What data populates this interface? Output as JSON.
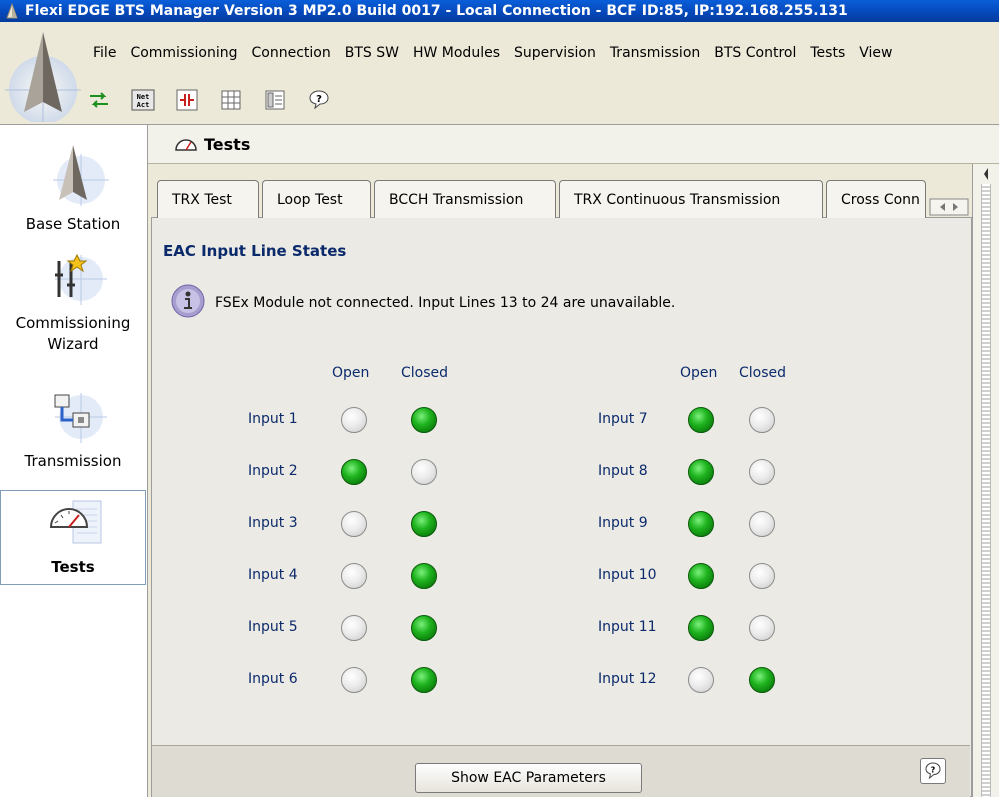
{
  "window": {
    "title": "Flexi EDGE BTS Manager Version 3 MP2.0 Build 0017 - Local Connection - BCF ID:85,  IP:192.168.255.131"
  },
  "menu": [
    "File",
    "Commissioning",
    "Connection",
    "BTS SW",
    "HW Modules",
    "Supervision",
    "Transmission",
    "BTS Control",
    "Tests",
    "View"
  ],
  "toolbar": {
    "buttons": [
      "transfer-icon",
      "net-act-icon",
      "connect-icon",
      "grid-icon",
      "panel-icon",
      "help-icon"
    ],
    "net_act_label": "Net Act"
  },
  "nav": {
    "items": [
      {
        "label": "Base Station",
        "icon": "base-station-icon"
      },
      {
        "label": "Commissioning Wizard",
        "label_line1": "Commissioning",
        "label_line2": "Wizard",
        "icon": "wizard-icon"
      },
      {
        "label": "Transmission",
        "icon": "transmission-icon"
      },
      {
        "label": "Tests",
        "icon": "tests-icon",
        "selected": true
      }
    ]
  },
  "header": {
    "title": "Tests"
  },
  "tabs": [
    {
      "label": "TRX Test"
    },
    {
      "label": "Loop Test"
    },
    {
      "label": "BCCH Transmission"
    },
    {
      "label": "TRX Continuous Transmission"
    },
    {
      "label": "Cross Conn"
    }
  ],
  "panel": {
    "title": "EAC Input Line States",
    "info": "FSEx Module not connected. Input Lines 13 to 24 are unavailable.",
    "col_open": "Open",
    "col_closed": "Closed",
    "inputs_left": [
      {
        "label": "Input 1",
        "state": "closed"
      },
      {
        "label": "Input 2",
        "state": "open"
      },
      {
        "label": "Input 3",
        "state": "closed"
      },
      {
        "label": "Input 4",
        "state": "closed"
      },
      {
        "label": "Input 5",
        "state": "closed"
      },
      {
        "label": "Input 6",
        "state": "closed"
      }
    ],
    "inputs_right": [
      {
        "label": "Input 7",
        "state": "open"
      },
      {
        "label": "Input 8",
        "state": "open"
      },
      {
        "label": "Input 9",
        "state": "open"
      },
      {
        "label": "Input 10",
        "state": "open"
      },
      {
        "label": "Input 11",
        "state": "open"
      },
      {
        "label": "Input 12",
        "state": "closed"
      }
    ],
    "button": "Show EAC Parameters"
  },
  "colors": {
    "title_bar": "#0547b8",
    "label_text": "#0b2a6b",
    "led_on": "#1fb41f",
    "led_off": "#e0e0e0"
  }
}
